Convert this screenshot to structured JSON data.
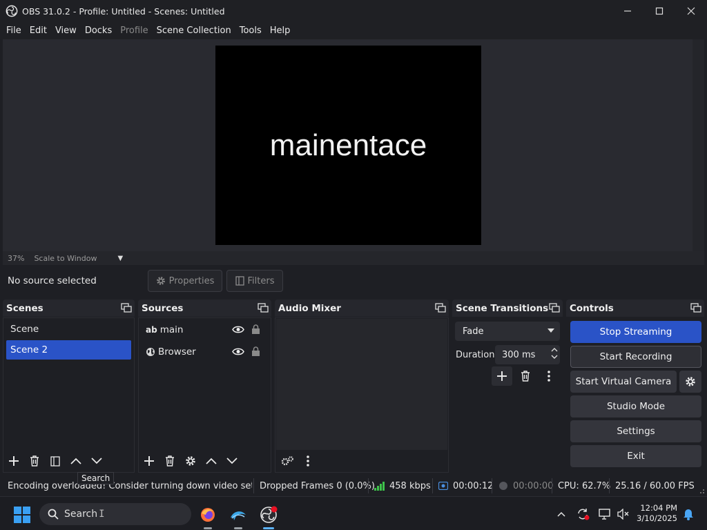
{
  "window": {
    "title": "OBS 31.0.2 - Profile: Untitled - Scenes: Untitled"
  },
  "menu": [
    {
      "label": "File",
      "disabled": false
    },
    {
      "label": "Edit",
      "disabled": false
    },
    {
      "label": "View",
      "disabled": false
    },
    {
      "label": "Docks",
      "disabled": false
    },
    {
      "label": "Profile",
      "disabled": true
    },
    {
      "label": "Scene Collection",
      "disabled": false
    },
    {
      "label": "Tools",
      "disabled": false
    },
    {
      "label": "Help",
      "disabled": false
    }
  ],
  "preview": {
    "text": "mainentace",
    "zoom": "37%",
    "scale_mode": "Scale to Window"
  },
  "source_toolbar": {
    "status": "No source selected",
    "properties_label": "Properties",
    "filters_label": "Filters"
  },
  "scenes": {
    "title": "Scenes",
    "items": [
      "Scene",
      "Scene 2"
    ],
    "selected_index": 1
  },
  "sources": {
    "title": "Sources",
    "items": [
      {
        "name": "main",
        "type": "text"
      },
      {
        "name": "Browser",
        "type": "browser"
      }
    ]
  },
  "audio_mixer": {
    "title": "Audio Mixer"
  },
  "transitions": {
    "title": "Scene Transitions",
    "selected": "Fade",
    "duration_label": "Duration",
    "duration_value": "300 ms"
  },
  "controls": {
    "title": "Controls",
    "stop_streaming": "Stop Streaming",
    "start_recording": "Start Recording",
    "start_virtual_camera": "Start Virtual Camera",
    "studio_mode": "Studio Mode",
    "settings": "Settings",
    "exit": "Exit"
  },
  "tooltip": "Search",
  "status": {
    "message": "Encoding overloaded! Consider turning down video setting",
    "dropped_frames": "Dropped Frames 0 (0.0%)",
    "bitrate": "458 kbps",
    "stream_time": "00:00:12",
    "record_time": "00:00:00",
    "cpu": "CPU: 62.7%",
    "fps": "25.16 / 60.00 FPS"
  },
  "taskbar": {
    "search_label": "Search",
    "time": "12:04 PM",
    "date": "3/10/2025"
  },
  "colors": {
    "accent": "#2a53c7",
    "bitrate_good": "#3ec24b",
    "notification": "#e81123"
  }
}
